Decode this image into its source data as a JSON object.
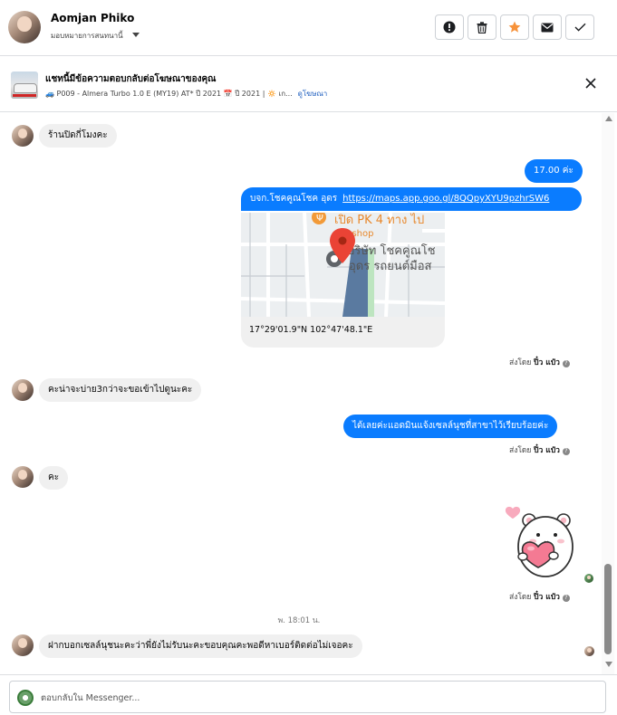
{
  "header": {
    "user_name": "Aomjan Phiko",
    "assign_label": "มอบหมายการสนทนานี้",
    "actions": [
      {
        "icon": "alert-icon",
        "label": "Mark as spam"
      },
      {
        "icon": "trash-icon",
        "label": "Delete"
      },
      {
        "icon": "star-icon",
        "label": "Follow up",
        "color": "#f7923a"
      },
      {
        "icon": "envelope-icon",
        "label": "Mark as unread"
      },
      {
        "icon": "check-icon",
        "label": "Mark as done"
      }
    ]
  },
  "ad": {
    "title": "แชทนี้มีข้อความตอบกลับต่อโฆษณาของคุณ",
    "subtitle": "🚙 P009 - Almera Turbo 1.0 E (MY19) AT* ปี 2021 📅 ปี 2021 | 🔅 เก...",
    "view_ad_link": "ดูโฆษณา"
  },
  "messages": [
    {
      "direction": "in",
      "text": "ร้านปิดกี่โมงคะ"
    },
    {
      "direction": "out",
      "text": "17.00 ค่ะ"
    },
    {
      "direction": "out",
      "text": "บจก.โชคคูณโชค อุดร",
      "link": "https://maps.app.goo.gl/8QQpyXYU9pzhrSW6"
    },
    {
      "direction": "out",
      "type": "map",
      "map_text_1": "เปิด PK 4 ทาง ไป",
      "map_text_2": "dle shop",
      "map_text_3": "บริษัท โชคคูณโช",
      "map_text_4": "อุดร รถยนต์มือส",
      "coords": "17°29'01.9\"N 102°47'48.1\"E"
    },
    {
      "direction": "in",
      "text": "คะน่าจะบ่าย3กว่าจะขอเข้าไปดูนะคะ"
    },
    {
      "direction": "out",
      "text": "ได้เลยค่ะแอดมินแจ้งเซลล์นุชที่สาขาไว้เรียบร้อยค่ะ"
    },
    {
      "direction": "in",
      "text": "คะ"
    },
    {
      "direction": "out",
      "type": "sticker",
      "sticker": "bear-heart-sticker"
    },
    {
      "direction": "in",
      "text": "ฝากบอกเซลล์นุชนะคะว่าพี่ยังไม่รับนะคะขอบคุณคะพอดีหาเบอร์ติดต่อไม่เจอคะ"
    }
  ],
  "sent_by": {
    "prefix": "ส่งโดย",
    "name": "ปิ๋ว แป๋ว",
    "help": "?"
  },
  "timestamp": "พ. 18:01 น.",
  "composer": {
    "placeholder": "ตอบกลับใน Messenger..."
  },
  "colors": {
    "outgoing_bubble": "#0a7cff",
    "incoming_bubble": "#f0f0f0",
    "follow_up_star": "#f7923a",
    "map_pin": "#ea4335"
  }
}
